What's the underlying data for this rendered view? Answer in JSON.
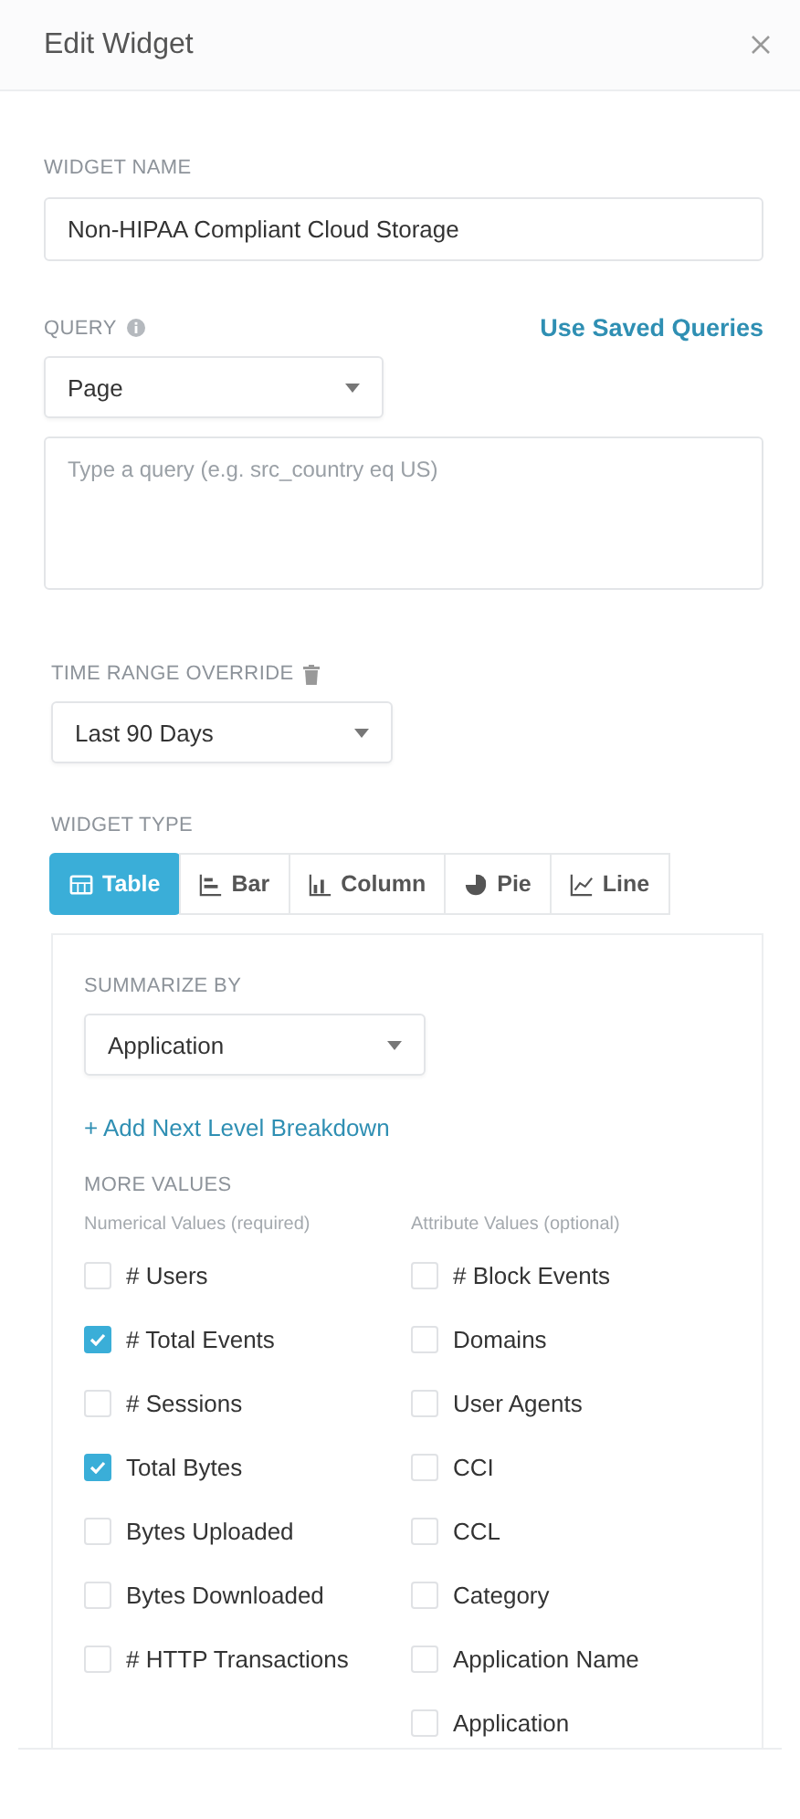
{
  "dialog": {
    "title": "Edit Widget"
  },
  "widget_name": {
    "label": "WIDGET NAME",
    "value": "Non-HIPAA Compliant Cloud Storage"
  },
  "query": {
    "label": "QUERY",
    "link": "Use Saved Queries",
    "select": "Page",
    "placeholder": "Type a query (e.g. src_country eq US)"
  },
  "time_range": {
    "label": "TIME RANGE OVERRIDE",
    "select": "Last 90 Days"
  },
  "widget_type": {
    "label": "WIDGET TYPE",
    "tabs": [
      {
        "label": "Table",
        "kind": "table",
        "selected": true
      },
      {
        "label": "Bar",
        "kind": "bar",
        "selected": false
      },
      {
        "label": "Column",
        "kind": "column",
        "selected": false
      },
      {
        "label": "Pie",
        "kind": "pie",
        "selected": false
      },
      {
        "label": "Line",
        "kind": "line",
        "selected": false
      }
    ]
  },
  "summarize": {
    "label": "SUMMARIZE BY",
    "select": "Application",
    "add_link": "+ Add Next Level Breakdown"
  },
  "more_values": {
    "label": "MORE VALUES",
    "columns": [
      {
        "heading": "Numerical Values (required)",
        "items": [
          {
            "label": "# Users",
            "checked": false
          },
          {
            "label": "# Total Events",
            "checked": true
          },
          {
            "label": "# Sessions",
            "checked": false
          },
          {
            "label": "Total Bytes",
            "checked": true
          },
          {
            "label": "Bytes Uploaded",
            "checked": false
          },
          {
            "label": "Bytes Downloaded",
            "checked": false
          },
          {
            "label": "# HTTP Transactions",
            "checked": false
          }
        ]
      },
      {
        "heading": "Attribute Values (optional)",
        "items": [
          {
            "label": "# Block Events",
            "checked": false
          },
          {
            "label": "Domains",
            "checked": false
          },
          {
            "label": "User Agents",
            "checked": false
          },
          {
            "label": "CCI",
            "checked": false
          },
          {
            "label": "CCL",
            "checked": false
          },
          {
            "label": "Category",
            "checked": false
          },
          {
            "label": "Application Name",
            "checked": false
          },
          {
            "label": "Application",
            "checked": false
          }
        ]
      }
    ]
  }
}
